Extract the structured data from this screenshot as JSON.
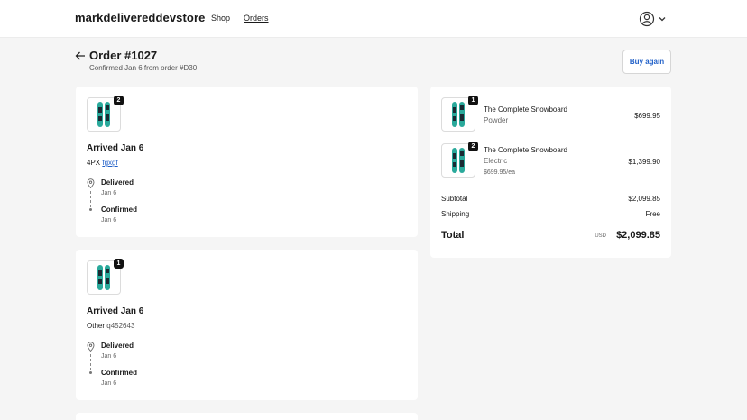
{
  "header": {
    "store_name": "markdelivereddevstore",
    "nav": [
      "Shop",
      "Orders"
    ]
  },
  "order": {
    "title": "Order #1027",
    "subtitle": "Confirmed Jan 6 from order #D30",
    "buy_again_label": "Buy again"
  },
  "shipments": [
    {
      "quantity": "2",
      "title": "Arrived Jan 6",
      "carrier": "4PX",
      "tracking": "fgxgf",
      "timeline": [
        {
          "label": "Delivered",
          "date": "Jan 6"
        },
        {
          "label": "Confirmed",
          "date": "Jan 6"
        }
      ]
    },
    {
      "quantity": "1",
      "title": "Arrived Jan 6",
      "carrier": "Other",
      "tracking": "q452643",
      "timeline": [
        {
          "label": "Delivered",
          "date": "Jan 6"
        },
        {
          "label": "Confirmed",
          "date": "Jan 6"
        }
      ]
    }
  ],
  "summary": {
    "items": [
      {
        "quantity": "1",
        "name": "The Complete Snowboard",
        "variant": "Powder",
        "each": "",
        "price": "$699.95"
      },
      {
        "quantity": "2",
        "name": "The Complete Snowboard",
        "variant": "Electric",
        "each": "$699.95/ea",
        "price": "$1,399.90"
      }
    ],
    "subtotal_label": "Subtotal",
    "subtotal": "$2,099.85",
    "shipping_label": "Shipping",
    "shipping": "Free",
    "total_label": "Total",
    "currency": "USD",
    "total": "$2,099.85"
  },
  "colors": {
    "link": "#1f5fc8",
    "board_teal": "#2aa99b",
    "board_dark": "#1b2a33"
  },
  "icons": [
    "account-icon",
    "chevron-down-icon",
    "back-arrow-icon",
    "location-pin-icon"
  ]
}
